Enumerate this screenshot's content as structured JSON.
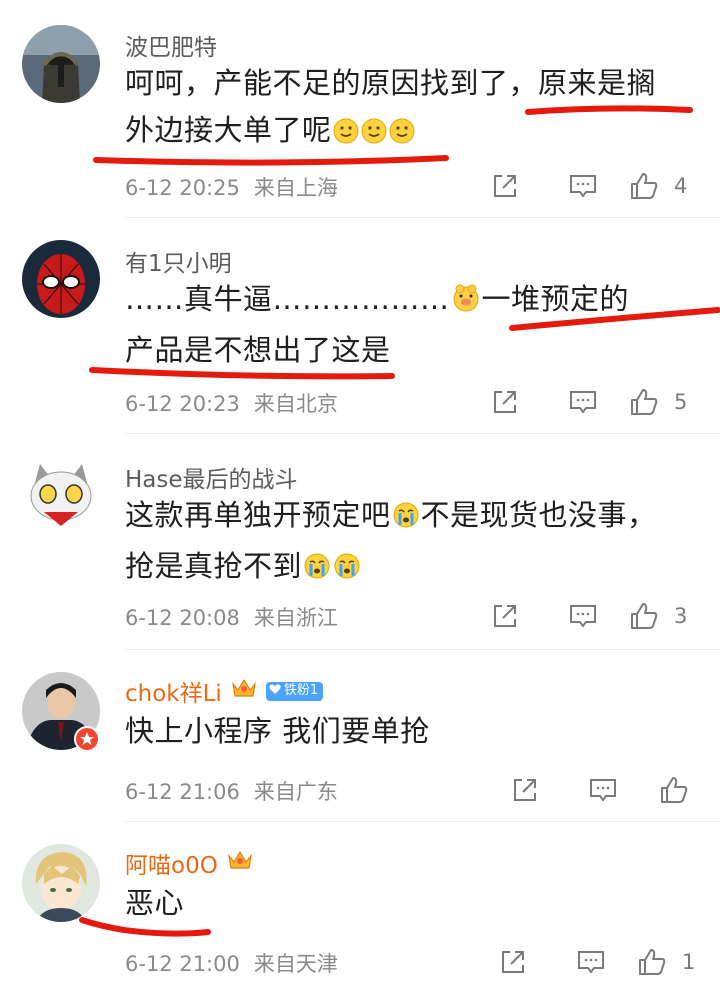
{
  "comments": [
    {
      "username": "波巴肥特",
      "line1": "呵呵，产能不足的原因找到了，原来是搁",
      "line2": "外边接大单了呢",
      "date": "6-12 20:25",
      "location": "来自上海",
      "likes": "4"
    },
    {
      "username": "有1只小明",
      "line1a": "……真牛逼………………",
      "line1b": "一堆预定的",
      "line2": "产品是不想出了这是",
      "date": "6-12 20:23",
      "location": "来自北京",
      "likes": "5"
    },
    {
      "username": "Hase最后的战斗",
      "line1a": "这款再单独开预定吧",
      "line1b": "不是现货也没事，",
      "line2": "抢是真抢不到",
      "date": "6-12 20:08",
      "location": "来自浙江",
      "likes": "3"
    },
    {
      "username": "chok祥Li",
      "badge": "铁粉1",
      "line1": "快上小程序 我们要单抢",
      "date": "6-12 21:06",
      "location": "来自广东",
      "likes": ""
    },
    {
      "username": "阿喵o0O",
      "line1": "恶心",
      "date": "6-12 21:00",
      "location": "来自天津",
      "likes": "1"
    }
  ],
  "icons": {
    "share": "share-icon",
    "comment": "comment-icon",
    "like": "like-icon",
    "crown": "crown-icon",
    "verified": "verified-badge-icon"
  },
  "colors": {
    "vip_name": "#e86a16",
    "annotation": "#e41b0c",
    "badge": "#4aa3ff"
  }
}
